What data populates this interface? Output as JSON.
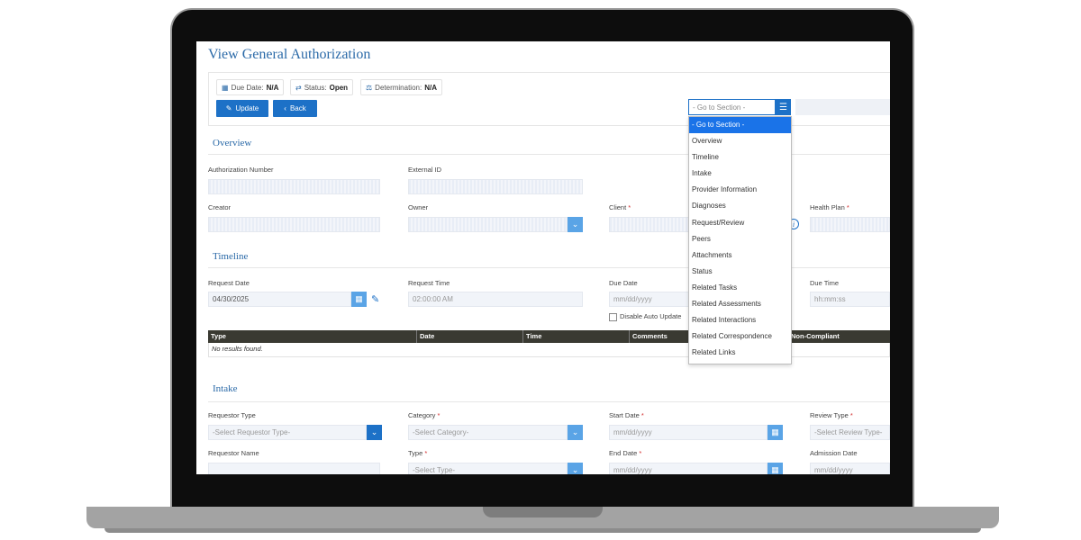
{
  "page": {
    "title": "View General Authorization"
  },
  "chips": {
    "due_date": {
      "label": "Due Date:",
      "value": "N/A"
    },
    "status": {
      "label": "Status:",
      "value": "Open"
    },
    "determination": {
      "label": "Determination:",
      "value": "N/A"
    }
  },
  "buttons": {
    "update": "Update",
    "back": "Back"
  },
  "goto": {
    "placeholder": "- Go to Section -",
    "options": [
      "- Go to Section -",
      "Overview",
      "Timeline",
      "Intake",
      "Provider Information",
      "Diagnoses",
      "Request/Review",
      "Peers",
      "Attachments",
      "Status",
      "Related Tasks",
      "Related Assessments",
      "Related Interactions",
      "Related Correspondence",
      "Related Links"
    ],
    "selected_index": 0
  },
  "overview": {
    "title": "Overview",
    "authorization_number": "Authorization Number",
    "external_id": "External ID",
    "creator": "Creator",
    "owner": "Owner",
    "client": "Client",
    "health_plan": "Health Plan",
    "required_mark": "*"
  },
  "timeline": {
    "title": "Timeline",
    "request_date_label": "Request Date",
    "request_date_value": "04/30/2025",
    "request_time_label": "Request Time",
    "request_time_value": "02:00:00 AM",
    "due_date_label": "Due Date",
    "due_date_placeholder": "mm/dd/yyyy",
    "due_time_label": "Due Time",
    "due_time_placeholder": "hh:mm:ss",
    "disable_auto_update": "Disable Auto Update",
    "table": {
      "columns": [
        "Type",
        "Date",
        "Time",
        "Comments",
        "Non-Compliant"
      ],
      "empty_text": "No results found."
    }
  },
  "intake": {
    "title": "Intake",
    "requestor_type_label": "Requestor Type",
    "requestor_type_placeholder": "-Select Requestor Type-",
    "category_label": "Category",
    "category_placeholder": "-Select Category-",
    "start_date_label": "Start Date",
    "start_date_placeholder": "mm/dd/yyyy",
    "review_type_label": "Review Type",
    "review_type_placeholder": "-Select Review Type-",
    "requestor_name_label": "Requestor Name",
    "type_label": "Type",
    "type_placeholder": "-Select Type-",
    "end_date_label": "End Date",
    "end_date_placeholder": "mm/dd/yyyy",
    "admission_date_label": "Admission Date",
    "admission_date_placeholder": "mm/dd/yyyy"
  },
  "icons": {
    "calendar": "calendar-icon",
    "status": "status-icon",
    "determination": "scale-icon",
    "update": "edit-icon",
    "back": "chevron-left-icon",
    "list": "list-icon",
    "chevron_down": "chevron-down-icon",
    "pencil": "pencil-icon",
    "info": "info-icon"
  },
  "colors": {
    "accent": "#1d71c7",
    "title": "#2b6aa8",
    "table_header": "#3a3a32",
    "dropdown_selected": "#1a73e8"
  }
}
